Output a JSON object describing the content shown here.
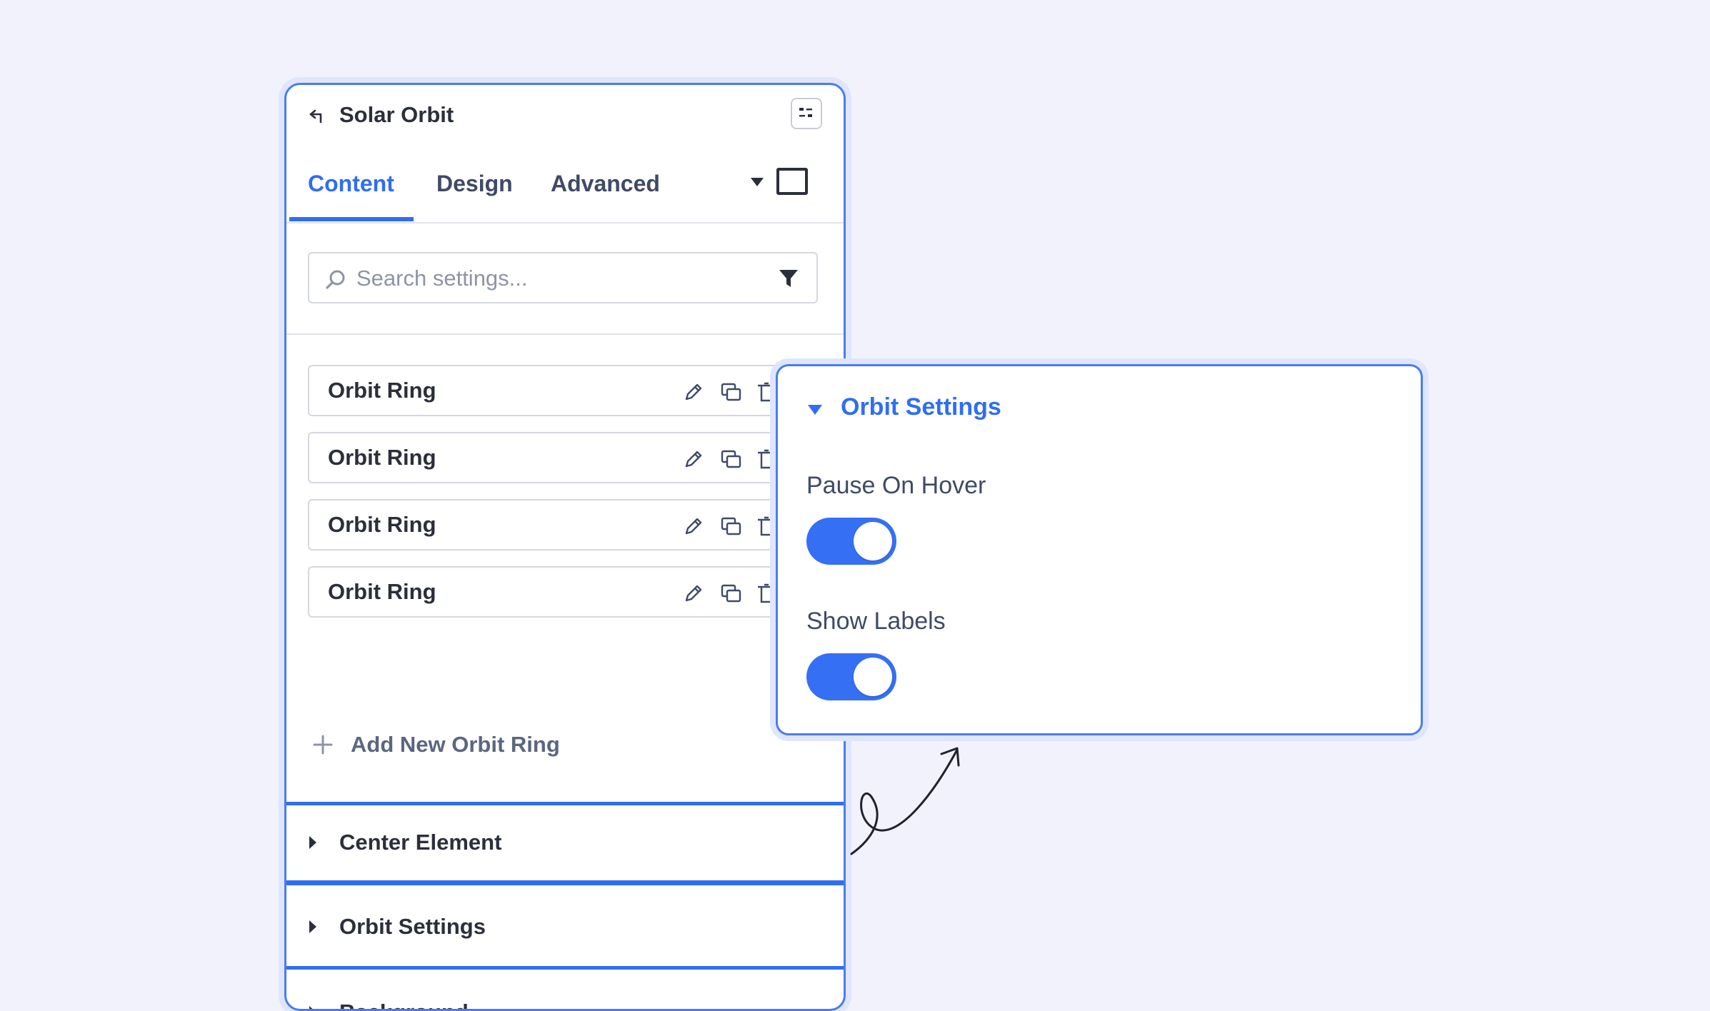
{
  "panel": {
    "title": "Solar Orbit",
    "tabs": [
      {
        "label": "Content",
        "active": true
      },
      {
        "label": "Design",
        "active": false
      },
      {
        "label": "Advanced",
        "active": false
      }
    ],
    "search": {
      "placeholder": "Search settings...",
      "value": ""
    },
    "repeater": {
      "items": [
        {
          "label": "Orbit Ring"
        },
        {
          "label": "Orbit Ring"
        },
        {
          "label": "Orbit Ring"
        },
        {
          "label": "Orbit Ring"
        }
      ],
      "add_label": "Add New Orbit Ring"
    },
    "sections": [
      {
        "label": "Center Element",
        "expanded": false
      },
      {
        "label": "Orbit Settings",
        "expanded": false,
        "highlighted": true
      },
      {
        "label": "Background",
        "expanded": false
      }
    ]
  },
  "popup": {
    "title": "Orbit Settings",
    "fields": [
      {
        "label": "Pause On Hover",
        "on": true
      },
      {
        "label": "Show Labels",
        "on": true
      }
    ]
  },
  "colors": {
    "accent": "#2f6ef2",
    "toggle_on": "#356ff4",
    "background": "#f2f2fd",
    "panel_border": "#4a7cf0"
  },
  "icons": [
    "back-arrow-icon",
    "layout-icon",
    "caret-down-icon",
    "square-icon",
    "search-icon",
    "filter-icon",
    "edit-icon",
    "duplicate-icon",
    "delete-icon",
    "plus-icon",
    "caret-right-icon",
    "arrow-doodle-icon"
  ]
}
